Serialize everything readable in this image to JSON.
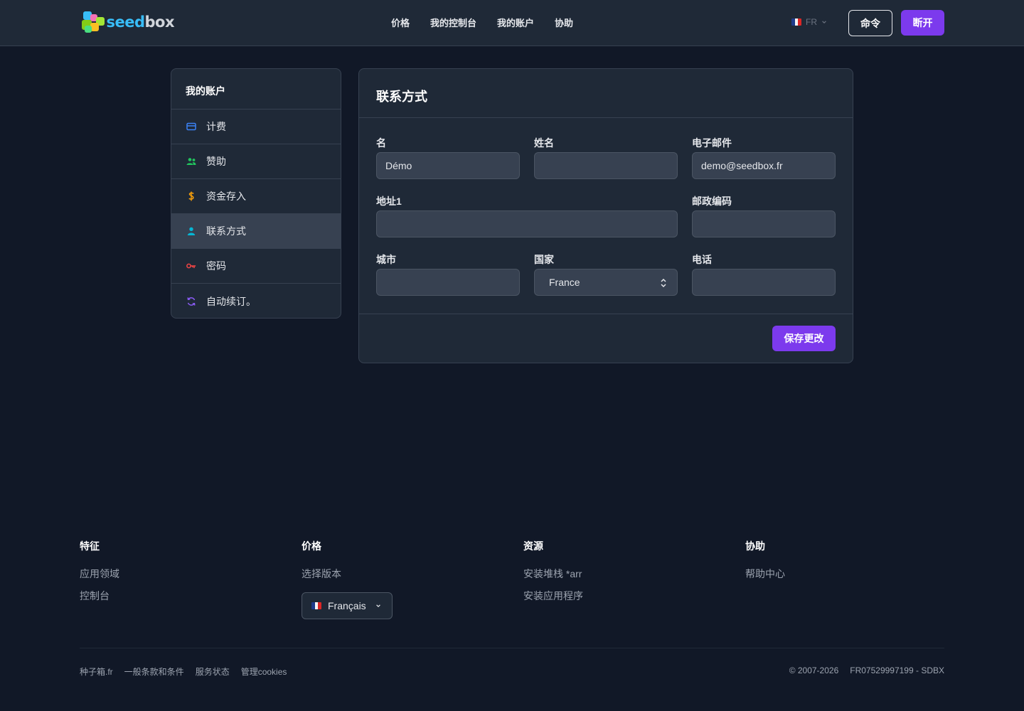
{
  "header": {
    "logo_text_a": "seed",
    "logo_text_b": "box",
    "nav": [
      "价格",
      "我的控制台",
      "我的账户",
      "协助"
    ],
    "lang_code": "FR",
    "orders_label": "命令",
    "logout_label": "断开"
  },
  "sidebar": {
    "title": "我的账户",
    "items": [
      {
        "label": "计费",
        "icon": "credit-card-icon",
        "color": "#3b82f6"
      },
      {
        "label": "赞助",
        "icon": "users-icon",
        "color": "#22c55e"
      },
      {
        "label": "资金存入",
        "icon": "dollar-icon",
        "color": "#f59e0b"
      },
      {
        "label": "联系方式",
        "icon": "user-icon",
        "color": "#06b6d4"
      },
      {
        "label": "密码",
        "icon": "key-icon",
        "color": "#ef4444"
      },
      {
        "label": "自动续订。",
        "icon": "refresh-icon",
        "color": "#8b5cf6"
      }
    ],
    "active_index": 3
  },
  "form": {
    "title": "联系方式",
    "first_name_label": "名",
    "first_name_value": "Démo",
    "last_name_label": "姓名",
    "last_name_value": "",
    "email_label": "电子邮件",
    "email_value": "demo@seedbox.fr",
    "address_label": "地址1",
    "address_value": "",
    "postal_label": "邮政编码",
    "postal_value": "",
    "city_label": "城市",
    "city_value": "",
    "country_label": "国家",
    "country_value": "France",
    "phone_label": "电话",
    "phone_value": "",
    "save_label": "保存更改"
  },
  "footer": {
    "features_title": "特征",
    "features_links": [
      "应用领域",
      "控制台"
    ],
    "pricing_title": "价格",
    "pricing_links": [
      "选择版本"
    ],
    "language_value": "Français",
    "resources_title": "资源",
    "resources_links": [
      "安装堆栈 *arr",
      "安装应用程序"
    ],
    "help_title": "协助",
    "help_links": [
      "帮助中心"
    ],
    "bottom_links": [
      "种子箱.fr",
      "一般条款和条件",
      "服务状态",
      "管理cookies"
    ],
    "copyright": "© 2007-2026",
    "company_id": "FR07529997199 - SDBX"
  },
  "colors": {
    "accent": "#7c3aed",
    "background": "#111827",
    "surface": "#1f2937"
  }
}
